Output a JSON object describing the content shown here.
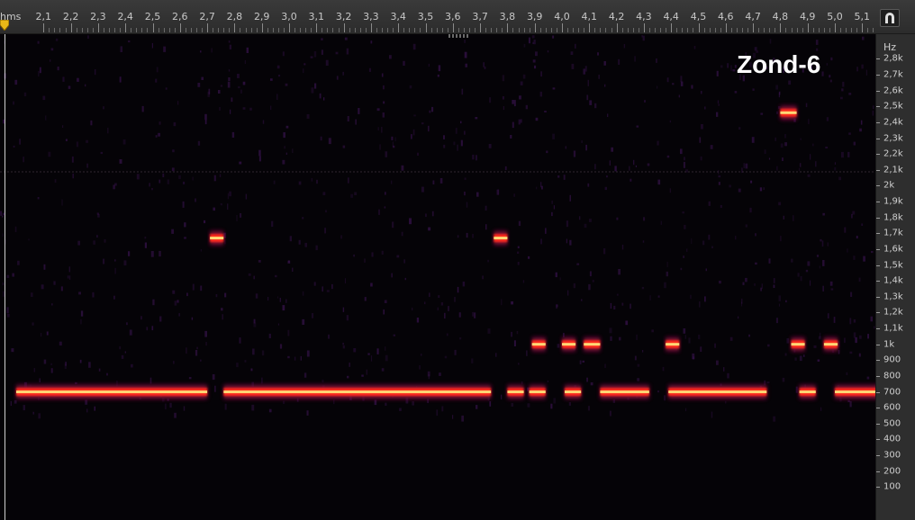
{
  "ruler": {
    "unit": "hms",
    "ticks": [
      "2,1",
      "2,2",
      "2,3",
      "2,4",
      "2,5",
      "2,6",
      "2,7",
      "2,8",
      "2,9",
      "3,0",
      "3,1",
      "3,2",
      "3,3",
      "3,4",
      "3,5",
      "3,6",
      "3,7",
      "3,8",
      "3,9",
      "4,0",
      "4,1",
      "4,2",
      "4,3",
      "4,4",
      "4,5",
      "4,6",
      "4,7",
      "4,8",
      "4,9",
      "5,0",
      "5,1"
    ],
    "start": 2.0,
    "end": 5.18,
    "icon": "magnet-icon"
  },
  "freq_axis": {
    "unit": "Hz",
    "labels": [
      "2,8k",
      "2,7k",
      "2,6k",
      "2,5k",
      "2,4k",
      "2,3k",
      "2,2k",
      "2,1k",
      "2k",
      "1,9k",
      "1,8k",
      "1,7k",
      "1,6k",
      "1,5k",
      "1,4k",
      "1,3k",
      "1,2k",
      "1,1k",
      "1k",
      "900",
      "800",
      "700",
      "600",
      "500",
      "400",
      "300",
      "200",
      "100"
    ],
    "values": [
      2800,
      2700,
      2600,
      2500,
      2400,
      2300,
      2200,
      2100,
      2000,
      1900,
      1800,
      1700,
      1600,
      1500,
      1400,
      1300,
      1200,
      1100,
      1000,
      900,
      800,
      700,
      600,
      500,
      400,
      300,
      200,
      100
    ]
  },
  "title": "Zond-6",
  "colors": {
    "background": "#050307",
    "tone_core": "#ffe27a",
    "tone_mid": "#ff2a1a",
    "tone_edge": "#7a0a3a",
    "noise": "#3a1450"
  },
  "tones": [
    {
      "t0": 2.0,
      "t1": 2.7,
      "f": 700
    },
    {
      "t0": 2.76,
      "t1": 3.74,
      "f": 700
    },
    {
      "t0": 3.8,
      "t1": 3.86,
      "f": 700
    },
    {
      "t0": 3.88,
      "t1": 3.94,
      "f": 700
    },
    {
      "t0": 4.01,
      "t1": 4.07,
      "f": 700
    },
    {
      "t0": 4.14,
      "t1": 4.32,
      "f": 700
    },
    {
      "t0": 4.39,
      "t1": 4.75,
      "f": 700
    },
    {
      "t0": 4.87,
      "t1": 4.93,
      "f": 700
    },
    {
      "t0": 5.0,
      "t1": 5.18,
      "f": 700
    },
    {
      "t0": 2.71,
      "t1": 2.76,
      "f": 1670
    },
    {
      "t0": 3.75,
      "t1": 3.8,
      "f": 1670
    },
    {
      "t0": 3.89,
      "t1": 3.94,
      "f": 1000
    },
    {
      "t0": 4.0,
      "t1": 4.05,
      "f": 1000
    },
    {
      "t0": 4.08,
      "t1": 4.14,
      "f": 1000
    },
    {
      "t0": 4.38,
      "t1": 4.43,
      "f": 1000
    },
    {
      "t0": 4.84,
      "t1": 4.89,
      "f": 1000
    },
    {
      "t0": 4.96,
      "t1": 5.01,
      "f": 1000
    },
    {
      "t0": 4.8,
      "t1": 4.86,
      "f": 2460
    }
  ]
}
